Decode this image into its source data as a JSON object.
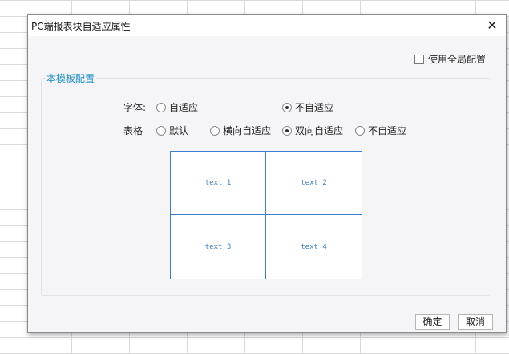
{
  "dialog": {
    "title": "PC端报表块自适应属性",
    "close_glyph": "✕"
  },
  "global_config": {
    "label": "使用全局配置",
    "checked": false
  },
  "section": {
    "legend": "本模板配置"
  },
  "font_row": {
    "label": "字体:",
    "options": [
      {
        "label": "自适应",
        "checked": false
      },
      {
        "label": "不自适应",
        "checked": true
      }
    ]
  },
  "table_row": {
    "label": "表格",
    "options": [
      {
        "label": "默认",
        "checked": false
      },
      {
        "label": "横向自适应",
        "checked": false
      },
      {
        "label": "双向自适应",
        "checked": true
      },
      {
        "label": "不自适应",
        "checked": false
      }
    ]
  },
  "preview": {
    "cells": [
      "text 1",
      "text 2",
      "text 3",
      "text 4"
    ]
  },
  "buttons": {
    "ok": "确定",
    "cancel": "取消"
  }
}
